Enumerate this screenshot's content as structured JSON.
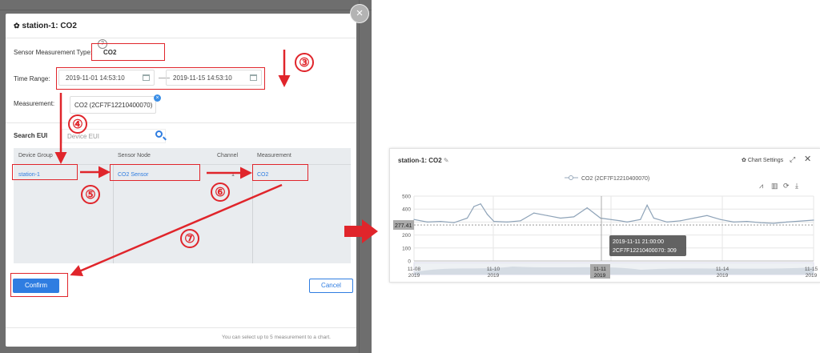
{
  "modal": {
    "title": "station-1: CO2",
    "sensor_type_label": "Sensor Measurement Type:",
    "sensor_type_value": "CO2",
    "time_range_label": "Time Range:",
    "start_time": "2019-11-01 14:53:10",
    "end_time": "2019-11-15 14:53:10",
    "measurement_label": "Measurement:",
    "measurement_value": "CO2 (2CF7F12210400070)",
    "search_label": "Search EUI",
    "search_placeholder": "Device EUI",
    "table": {
      "headers": [
        "Device Group",
        "Sensor Node",
        "Channel",
        "Measurement"
      ],
      "row": {
        "device_group": "station-1",
        "sensor_node": "CO2 Sensor",
        "channel": "1",
        "measurement": "CO2"
      }
    },
    "confirm_label": "Confirm",
    "cancel_label": "Cancel",
    "footnote": "You can select up to 5 measurement to a chart."
  },
  "annotations": {
    "step3": "③",
    "step4": "④",
    "step5": "⑤",
    "step6": "⑥",
    "step7": "⑦",
    "color": "#e0252b"
  },
  "chart_panel": {
    "title": "station-1:  CO2",
    "settings_label": "Chart Settings",
    "legend_label": "CO2 (2CF7F12210400070)",
    "cursor_value_label": "277.41",
    "tooltip_line1": "2019-11-11 21:00:00",
    "tooltip_line2": "2CF7F12210400070: 309",
    "cursor_x_label": "11-11"
  },
  "chart_data": {
    "type": "line",
    "series": [
      {
        "name": "CO2 (2CF7F12210400070)",
        "x": [
          "2019-11-08 00:00",
          "2019-11-08 06:00",
          "2019-11-08 12:00",
          "2019-11-08 18:00",
          "2019-11-09 00:00",
          "2019-11-09 03:00",
          "2019-11-09 06:00",
          "2019-11-09 09:00",
          "2019-11-09 12:00",
          "2019-11-09 18:00",
          "2019-11-10 00:00",
          "2019-11-10 06:00",
          "2019-11-10 12:00",
          "2019-11-10 18:00",
          "2019-11-11 00:00",
          "2019-11-11 06:00",
          "2019-11-11 12:00",
          "2019-11-11 21:00",
          "2019-11-12 00:00",
          "2019-11-12 06:00",
          "2019-11-12 09:00",
          "2019-11-12 12:00",
          "2019-11-12 18:00",
          "2019-11-13 00:00",
          "2019-11-13 06:00",
          "2019-11-13 12:00",
          "2019-11-13 18:00",
          "2019-11-14 00:00",
          "2019-11-14 06:00",
          "2019-11-14 12:00",
          "2019-11-14 18:00",
          "2019-11-15 00:00",
          "2019-11-15 12:00"
        ],
        "y": [
          320,
          300,
          305,
          295,
          330,
          420,
          440,
          360,
          305,
          300,
          310,
          370,
          350,
          330,
          340,
          410,
          330,
          309,
          300,
          320,
          430,
          330,
          300,
          310,
          330,
          350,
          320,
          300,
          305,
          295,
          290,
          300,
          315
        ]
      }
    ],
    "x_ticks": [
      "11-08\n2019",
      "11-10\n2019",
      "11-11\n2019",
      "11-14\n2019",
      "11-15\n2019"
    ],
    "y_ticks": [
      0,
      100,
      200,
      300,
      400,
      500
    ],
    "ylim": [
      0,
      500
    ],
    "reference_line": 277.41,
    "grid": true,
    "legend_position": "top-center"
  }
}
